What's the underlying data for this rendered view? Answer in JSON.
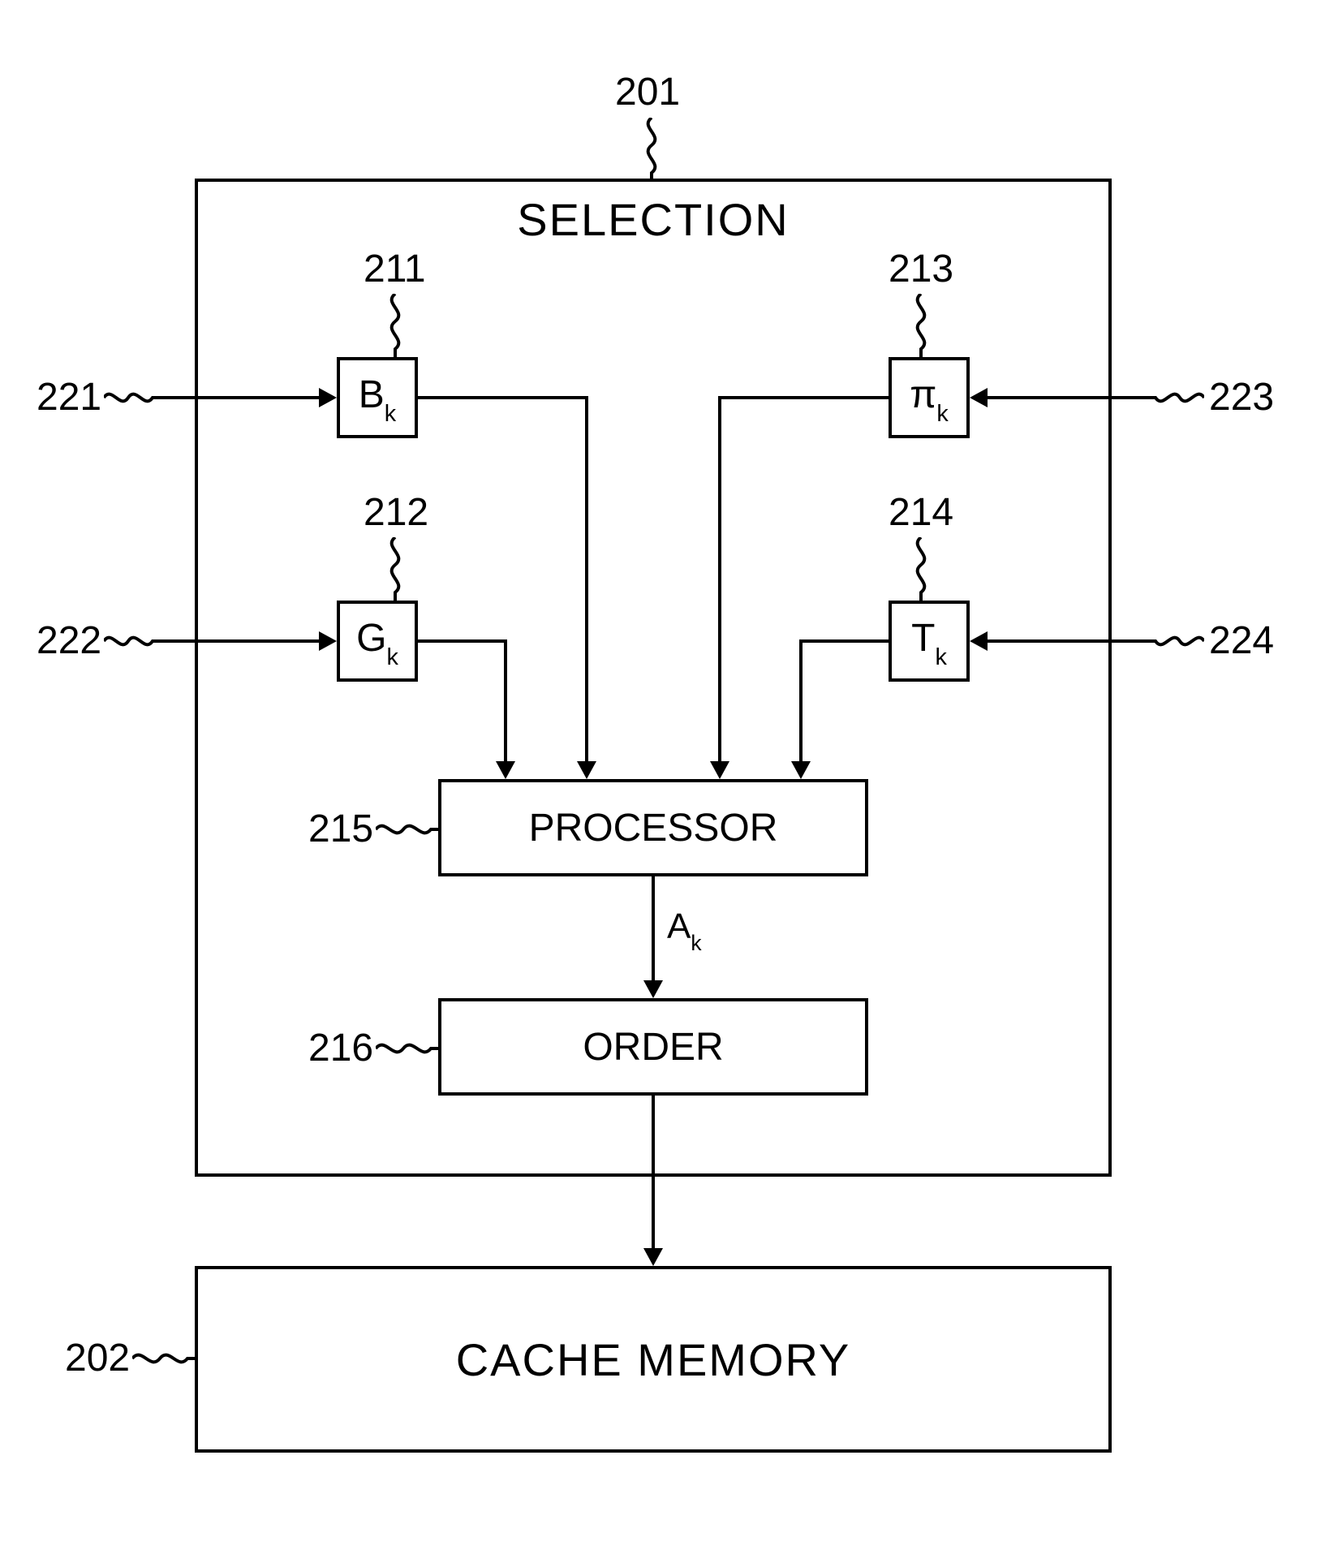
{
  "title": "SELECTION",
  "refs": {
    "r201": "201",
    "r202": "202",
    "r211": "211",
    "r212": "212",
    "r213": "213",
    "r214": "214",
    "r215": "215",
    "r216": "216",
    "r221": "221",
    "r222": "222",
    "r223": "223",
    "r224": "224"
  },
  "boxes": {
    "b211": "B",
    "b211_sub": "k",
    "b212": "G",
    "b212_sub": "k",
    "b213": "π",
    "b213_sub": "k",
    "b214": "T",
    "b214_sub": "k",
    "processor": "PROCESSOR",
    "order": "ORDER",
    "cache": "CACHE MEMORY"
  },
  "signals": {
    "ak": "A",
    "ak_sub": "k"
  }
}
